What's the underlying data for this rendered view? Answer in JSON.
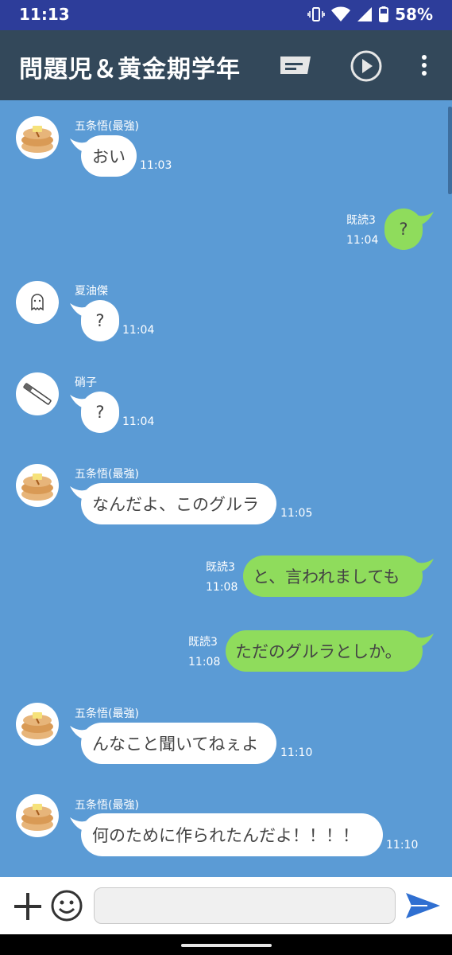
{
  "status": {
    "time": "11:13",
    "battery": "58%"
  },
  "header": {
    "title": "問題児＆黄金期学年",
    "icons": [
      "message-list-icon",
      "play-circle-icon",
      "more-vert-icon"
    ]
  },
  "messages": [
    {
      "side": "in",
      "sender": "五条悟(最強)",
      "avatar": "pancake-icon",
      "text": "おい",
      "time": "11:03"
    },
    {
      "side": "out",
      "read": "既読3",
      "text": "?",
      "time": "11:04"
    },
    {
      "side": "in",
      "sender": "夏油傑",
      "avatar": "ghost-icon",
      "text": "?",
      "time": "11:04"
    },
    {
      "side": "in",
      "sender": "硝子",
      "avatar": "cigarette-icon",
      "text": "?",
      "time": "11:04"
    },
    {
      "side": "in",
      "sender": "五条悟(最強)",
      "avatar": "pancake-icon",
      "text": "なんだよ、このグルラ",
      "time": "11:05"
    },
    {
      "side": "out",
      "read": "既読3",
      "text": "と、言われましても",
      "time": "11:08"
    },
    {
      "side": "out",
      "read": "既読3",
      "text": "ただのグルラとしか。",
      "time": "11:08"
    },
    {
      "side": "in",
      "sender": "五条悟(最強)",
      "avatar": "pancake-icon",
      "text": "んなこと聞いてねぇよ",
      "time": "11:10"
    },
    {
      "side": "in",
      "sender": "五条悟(最強)",
      "avatar": "pancake-icon",
      "text": "何のために作られたんだよ！！！！",
      "time": "11:10"
    }
  ],
  "composer": {
    "value": "",
    "placeholder": ""
  },
  "colors": {
    "chat_bg": "#5b9bd5",
    "out_bubble": "#8fdc5c",
    "in_bubble": "#ffffff",
    "app_bar": "#33485a",
    "status_bar": "#2d3d9a",
    "send": "#2f6fd1"
  }
}
